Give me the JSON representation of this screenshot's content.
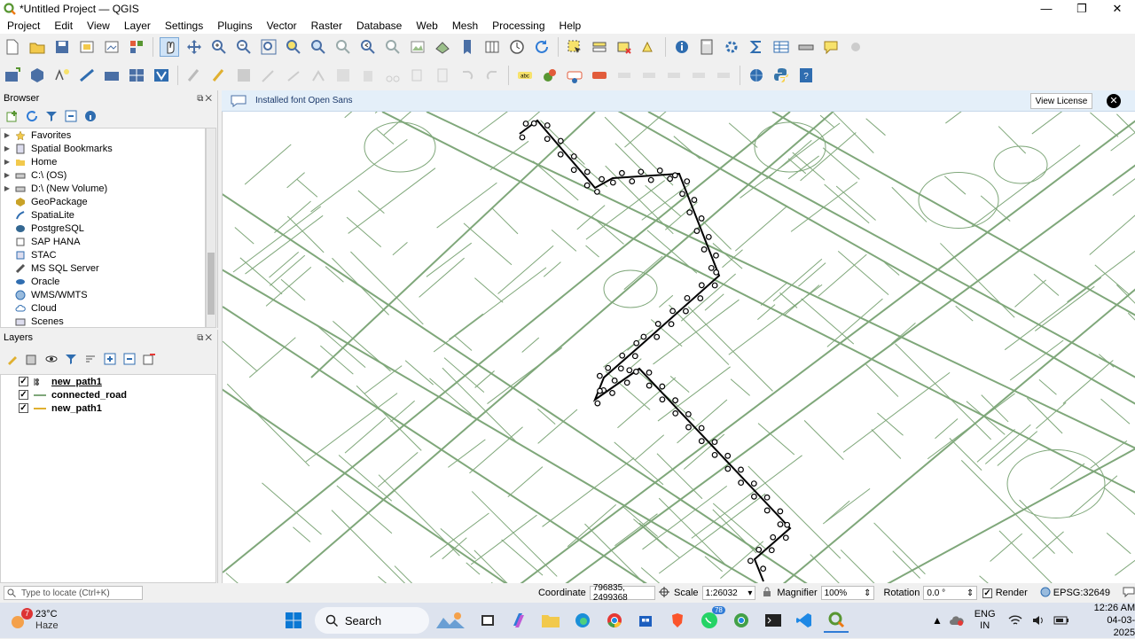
{
  "window": {
    "title": "*Untitled Project — QGIS",
    "controls": [
      "—",
      "❐",
      "✕"
    ]
  },
  "menu": [
    "Project",
    "Edit",
    "View",
    "Layer",
    "Settings",
    "Plugins",
    "Vector",
    "Raster",
    "Database",
    "Web",
    "Mesh",
    "Processing",
    "Help"
  ],
  "browser": {
    "title": "Browser",
    "items": [
      {
        "label": "Favorites",
        "icon": "star-icon"
      },
      {
        "label": "Spatial Bookmarks",
        "icon": "bookmark-icon"
      },
      {
        "label": "Home",
        "icon": "folder-icon"
      },
      {
        "label": "C:\\ (OS)",
        "icon": "drive-icon"
      },
      {
        "label": "D:\\ (New Volume)",
        "icon": "drive-icon"
      },
      {
        "label": "GeoPackage",
        "icon": "geopackage-icon"
      },
      {
        "label": "SpatiaLite",
        "icon": "spatialite-icon"
      },
      {
        "label": "PostgreSQL",
        "icon": "postgres-icon"
      },
      {
        "label": "SAP HANA",
        "icon": "database-icon"
      },
      {
        "label": "STAC",
        "icon": "stac-icon"
      },
      {
        "label": "MS SQL Server",
        "icon": "mssql-icon"
      },
      {
        "label": "Oracle",
        "icon": "oracle-icon"
      },
      {
        "label": "WMS/WMTS",
        "icon": "wms-icon"
      },
      {
        "label": "Cloud",
        "icon": "cloud-icon"
      },
      {
        "label": "Scenes",
        "icon": "scenes-icon"
      }
    ]
  },
  "layers": {
    "title": "Layers",
    "items": [
      {
        "label": "new_path1",
        "symbol": "point-line",
        "checked": true,
        "bold": true
      },
      {
        "label": "connected_road",
        "symbol": "green-line",
        "checked": true,
        "bold": true
      },
      {
        "label": "new_path1",
        "symbol": "yellow-line",
        "checked": true,
        "bold": true
      }
    ]
  },
  "message": {
    "text": "Installed font Open Sans",
    "button": "View License"
  },
  "status": {
    "locate_placeholder": "Type to locate (Ctrl+K)",
    "coordinate_label": "Coordinate",
    "coordinate_value": "796835, 2499368",
    "scale_label": "Scale",
    "scale_value": "1:26032",
    "magnifier_label": "Magnifier",
    "magnifier_value": "100%",
    "rotation_label": "Rotation",
    "rotation_value": "0.0 °",
    "render_label": "Render",
    "crs": "EPSG:32649"
  },
  "taskbar": {
    "weather_temp": "23°C",
    "weather_desc": "Haze",
    "weather_badge": "7",
    "search_label": "Search",
    "lang_top": "ENG",
    "lang_bottom": "IN",
    "time": "12:26 AM",
    "date": "04-03-2025",
    "whatsapp_badge": "78"
  },
  "colors": {
    "road": "#7fa77a",
    "path": "#000000",
    "message_bg": "#e4eff9",
    "taskbar_bg": "#dde3ee"
  }
}
